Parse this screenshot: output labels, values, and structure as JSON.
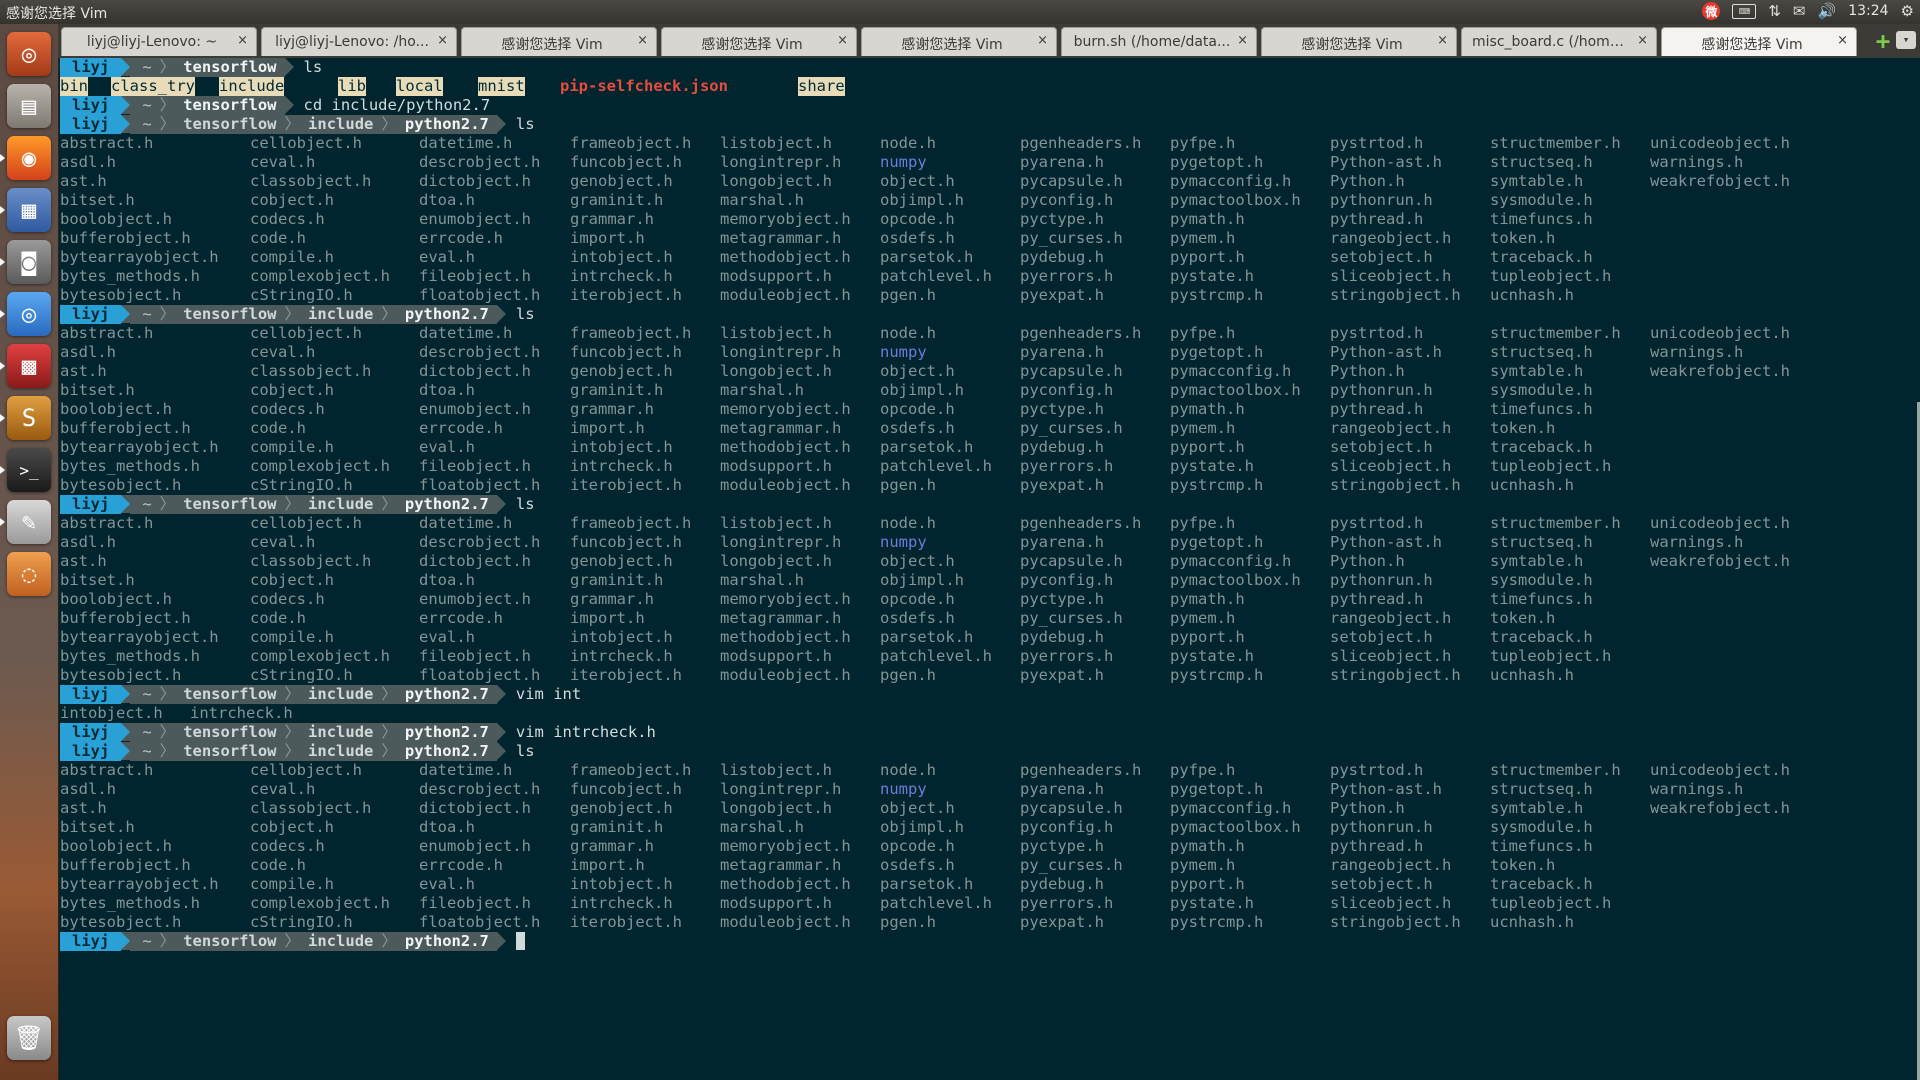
{
  "window": {
    "title": "感谢您选择 Vim"
  },
  "tray": {
    "clock": "13:24",
    "keyboard": "⌨"
  },
  "colors": {
    "background": "#00252f",
    "user_segment": "#2aa1d6",
    "path_segment": "#4d5a5c",
    "red_file": "#e84c3d",
    "blue_dir": "#6d7cd8"
  },
  "launcher": {
    "icons": [
      "ubuntu-dash-icon",
      "files-icon",
      "firefox-icon",
      "text-editor-icon",
      "camera-icon",
      "chromium-icon",
      "impress-icon",
      "sublime-icon",
      "terminal-icon",
      "gedit-icon",
      "ubuntu-one-icon",
      "trash-icon"
    ]
  },
  "tabs": [
    "liyj@liyj-Lenovo: ~",
    "liyj@liyj-Lenovo: /ho...",
    "感谢您选择 Vim",
    "感谢您选择 Vim",
    "感谢您选择 Vim",
    "burn.sh (/home/data...",
    "感谢您选择 Vim",
    "misc_board.c (/home/...",
    "感谢您选择 Vim"
  ],
  "tab_close": "×",
  "tab_add": "+",
  "tab_menu": "▾",
  "prompt": {
    "user": "liyj",
    "home": "~",
    "dirs": [
      "tensorflow",
      "include",
      "python2.7"
    ],
    "sep": "〉"
  },
  "first_listing": [
    "bin",
    "class_try",
    "include",
    "lib",
    "local",
    "mnist",
    "pip-selfcheck.json",
    "share"
  ],
  "commands": {
    "ls": "ls",
    "cd": "cd include/python2.7",
    "vim_int": "vim int",
    "vim_intrcheck": "vim intrcheck.h"
  },
  "completion": [
    "intobject.h",
    "intrcheck.h"
  ],
  "listing_rows": [
    [
      "abstract.h",
      "cellobject.h",
      "datetime.h",
      "frameobject.h",
      "listobject.h",
      "node.h",
      "pgenheaders.h",
      "pyfpe.h",
      "pystrtod.h",
      "structmember.h",
      "unicodeobject.h"
    ],
    [
      "asdl.h",
      "ceval.h",
      "descrobject.h",
      "funcobject.h",
      "longintrepr.h",
      "numpy",
      "pyarena.h",
      "pygetopt.h",
      "Python-ast.h",
      "structseq.h",
      "warnings.h"
    ],
    [
      "ast.h",
      "classobject.h",
      "dictobject.h",
      "genobject.h",
      "longobject.h",
      "object.h",
      "pycapsule.h",
      "pymacconfig.h",
      "Python.h",
      "symtable.h",
      "weakrefobject.h"
    ],
    [
      "bitset.h",
      "cobject.h",
      "dtoa.h",
      "graminit.h",
      "marshal.h",
      "objimpl.h",
      "pyconfig.h",
      "pymactoolbox.h",
      "pythonrun.h",
      "sysmodule.h",
      ""
    ],
    [
      "boolobject.h",
      "codecs.h",
      "enumobject.h",
      "grammar.h",
      "memoryobject.h",
      "opcode.h",
      "pyctype.h",
      "pymath.h",
      "pythread.h",
      "timefuncs.h",
      ""
    ],
    [
      "bufferobject.h",
      "code.h",
      "errcode.h",
      "import.h",
      "metagrammar.h",
      "osdefs.h",
      "py_curses.h",
      "pymem.h",
      "rangeobject.h",
      "token.h",
      ""
    ],
    [
      "bytearrayobject.h",
      "compile.h",
      "eval.h",
      "intobject.h",
      "methodobject.h",
      "parsetok.h",
      "pydebug.h",
      "pyport.h",
      "setobject.h",
      "traceback.h",
      ""
    ],
    [
      "bytes_methods.h",
      "complexobject.h",
      "fileobject.h",
      "intrcheck.h",
      "modsupport.h",
      "patchlevel.h",
      "pyerrors.h",
      "pystate.h",
      "sliceobject.h",
      "tupleobject.h",
      ""
    ],
    [
      "bytesobject.h",
      "cStringIO.h",
      "floatobject.h",
      "iterobject.h",
      "moduleobject.h",
      "pgen.h",
      "pyexpat.h",
      "pystrcmp.h",
      "stringobject.h",
      "ucnhash.h",
      ""
    ]
  ]
}
